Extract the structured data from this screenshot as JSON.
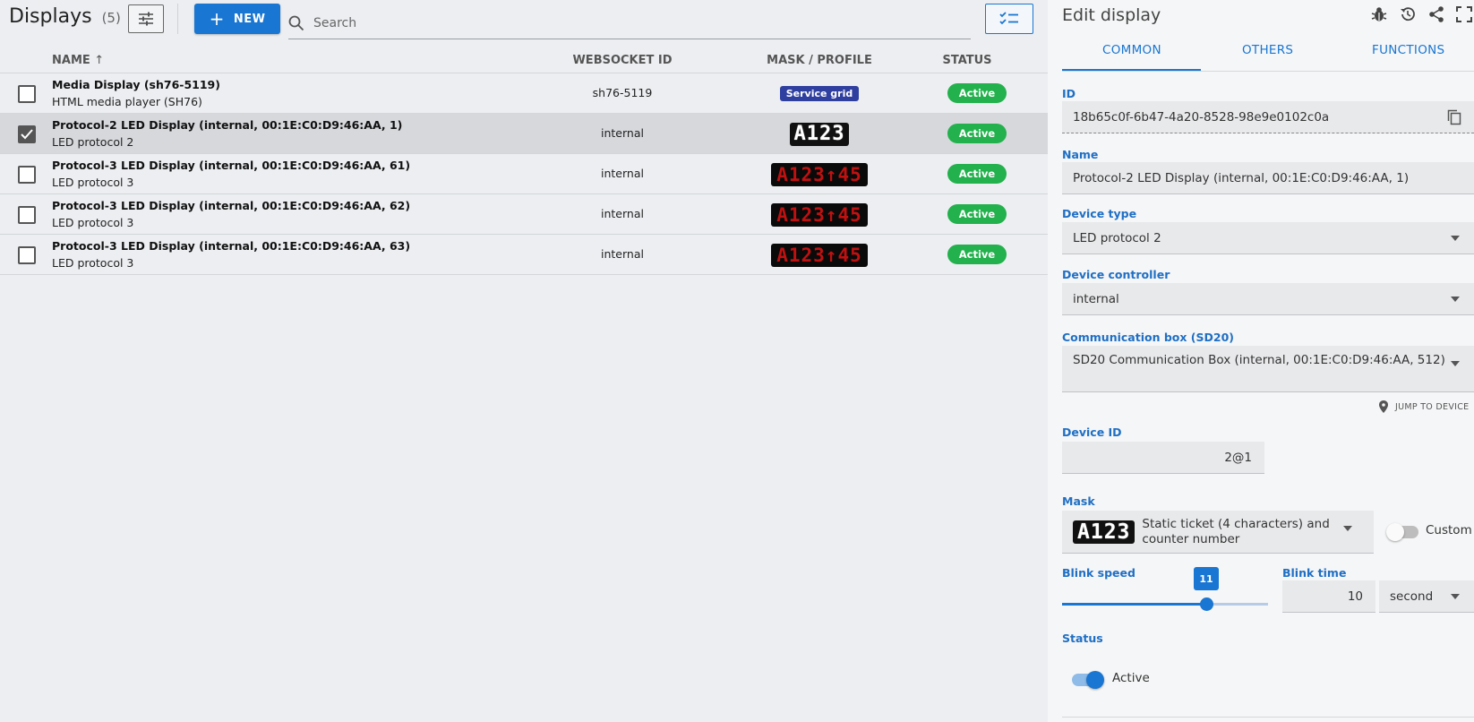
{
  "header": {
    "title": "Displays",
    "count": "(5)",
    "new_label": "NEW",
    "search_placeholder": "Search"
  },
  "table": {
    "columns": {
      "name": "NAME",
      "websocket": "WEBSOCKET ID",
      "mask": "MASK / PROFILE",
      "status": "STATUS"
    },
    "sort_arrow": "↑",
    "rows": [
      {
        "name": "Media Display (sh76-5119)",
        "subtitle": "HTML media player (SH76)",
        "websocket": "sh76-5119",
        "mask_kind": "badge",
        "mask_text": "Service grid",
        "status": "Active",
        "checked": false
      },
      {
        "name": "Protocol-2 LED Display (internal, 00:1E:C0:D9:46:AA, 1)",
        "subtitle": "LED protocol 2",
        "websocket": "internal",
        "mask_kind": "led-white",
        "mask_text": "A123",
        "status": "Active",
        "checked": true
      },
      {
        "name": "Protocol-3 LED Display (internal, 00:1E:C0:D9:46:AA, 61)",
        "subtitle": "LED protocol 3",
        "websocket": "internal",
        "mask_kind": "led-red",
        "mask_text": "A123↑45",
        "status": "Active",
        "checked": false
      },
      {
        "name": "Protocol-3 LED Display (internal, 00:1E:C0:D9:46:AA, 62)",
        "subtitle": "LED protocol 3",
        "websocket": "internal",
        "mask_kind": "led-red",
        "mask_text": "A123↑45",
        "status": "Active",
        "checked": false
      },
      {
        "name": "Protocol-3 LED Display (internal, 00:1E:C0:D9:46:AA, 63)",
        "subtitle": "LED protocol 3",
        "websocket": "internal",
        "mask_kind": "led-red",
        "mask_text": "A123↑45",
        "status": "Active",
        "checked": false
      }
    ]
  },
  "editor": {
    "title": "Edit display",
    "tabs": [
      "COMMON",
      "OTHERS",
      "FUNCTIONS"
    ],
    "active_tab": "COMMON",
    "id_label": "ID",
    "id_value": "18b65c0f-6b47-4a20-8528-98e9e0102c0a",
    "name_label": "Name",
    "name_value": "Protocol-2 LED Display (internal, 00:1E:C0:D9:46:AA, 1)",
    "device_type_label": "Device type",
    "device_type_value": "LED protocol 2",
    "controller_label": "Device controller",
    "controller_value": "internal",
    "commbox_label": "Communication box (SD20)",
    "commbox_value": "SD20 Communication Box (internal, 00:1E:C0:D9:46:AA, 512)",
    "jump_label": "JUMP TO DEVICE",
    "device_id_label": "Device ID",
    "device_id_value": "2@1",
    "mask_label": "Mask",
    "mask_preview": "A123",
    "mask_value": "Static ticket (4 characters) and counter number",
    "custom_label": "Custom",
    "custom_enabled": false,
    "blink_speed_label": "Blink speed",
    "blink_speed_value": "11",
    "blink_speed_fraction": 0.7,
    "blink_time_label": "Blink time",
    "blink_time_value": "10",
    "blink_time_unit": "second",
    "status_label": "Status",
    "status_value": "Active",
    "status_enabled": true
  },
  "colors": {
    "primary": "#1976d2",
    "active_green": "#22b14c",
    "badge_blue": "#2f3fa0",
    "led_red": "#c01111"
  },
  "icons": [
    "tune-icon",
    "plus-icon",
    "search-icon",
    "checklist-icon",
    "sort-up-icon",
    "bug-icon",
    "history-icon",
    "share-icon",
    "fullscreen-icon",
    "copy-icon",
    "location-pin-icon",
    "chevron-down-icon"
  ]
}
